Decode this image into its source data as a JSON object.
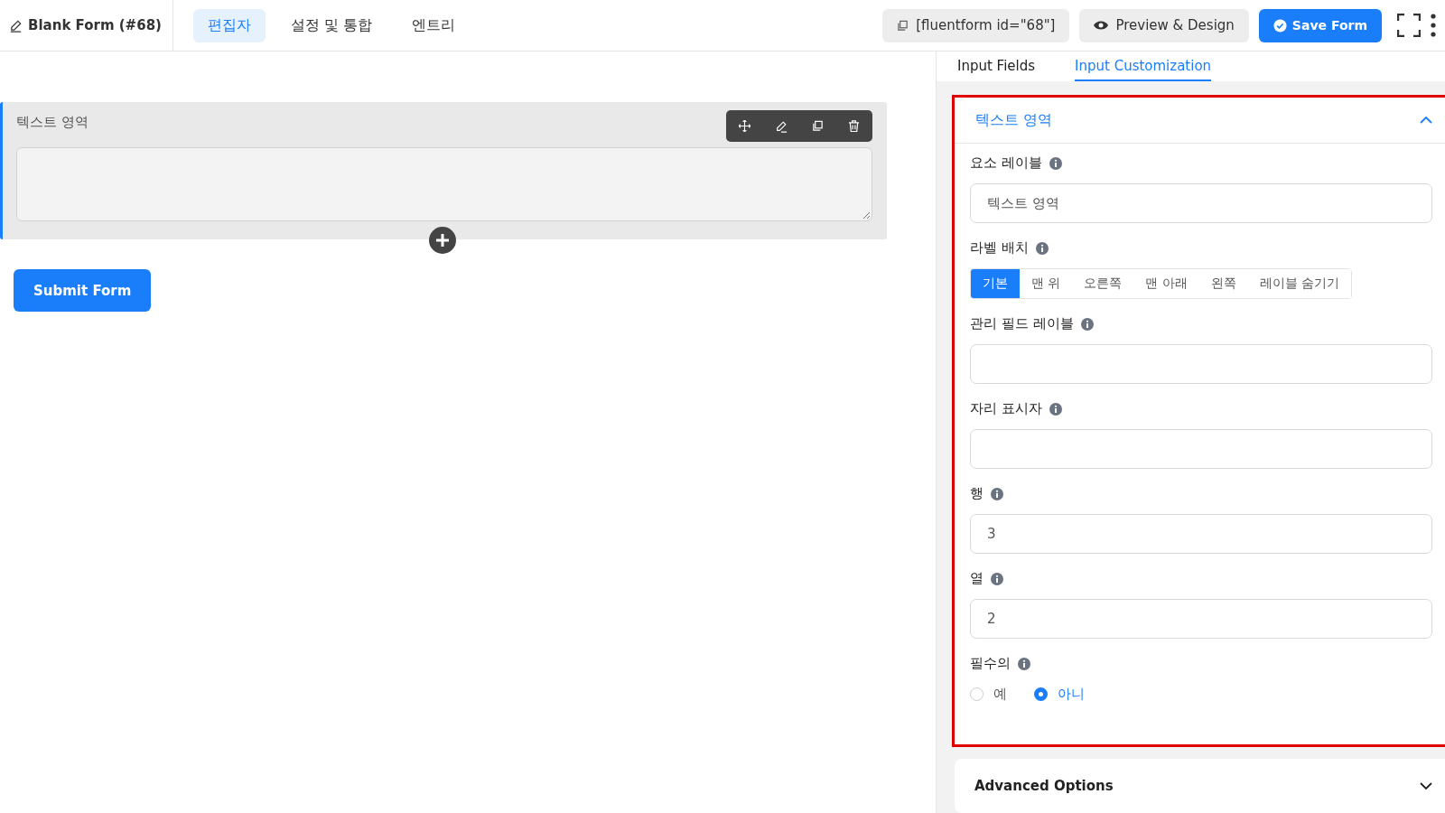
{
  "header": {
    "title": "Blank Form (#68)",
    "tabs": [
      {
        "label": "편집자",
        "selected": true
      },
      {
        "label": "설정 및 통합",
        "selected": false
      },
      {
        "label": "엔트리",
        "selected": false
      }
    ],
    "shortcode": "[fluentform id=\"68\"]",
    "preview": "Preview & Design",
    "save": "Save Form"
  },
  "canvas": {
    "field_label": "텍스트 영역",
    "submit": "Submit Form"
  },
  "panel": {
    "tabs": [
      {
        "label": "Input Fields",
        "selected": false
      },
      {
        "label": "Input Customization",
        "selected": true
      }
    ],
    "section": {
      "title": "텍스트 영역",
      "expanded": true,
      "fields": [
        {
          "kind": "text",
          "label": "요소 레이블",
          "value": "텍스트 영역"
        },
        {
          "kind": "segmented",
          "label": "라벨 배치",
          "options": [
            {
              "label": "기본",
              "selected": true
            },
            {
              "label": "맨 위",
              "selected": false
            },
            {
              "label": "오른쪽",
              "selected": false
            },
            {
              "label": "맨 아래",
              "selected": false
            },
            {
              "label": "왼쪽",
              "selected": false
            },
            {
              "label": "레이블 숨기기",
              "selected": false
            }
          ]
        },
        {
          "kind": "text",
          "label": "관리 필드 레이블"
        },
        {
          "kind": "text",
          "label": "자리 표시자"
        },
        {
          "kind": "text",
          "label": "행",
          "value": "3"
        },
        {
          "kind": "text",
          "label": "열",
          "value": "2"
        },
        {
          "kind": "radio",
          "label": "필수의",
          "options": [
            {
              "label": "예",
              "selected": false
            },
            {
              "label": "아니",
              "selected": true
            }
          ]
        }
      ]
    },
    "advanced": {
      "title": "Advanced Options",
      "expanded": false
    }
  }
}
